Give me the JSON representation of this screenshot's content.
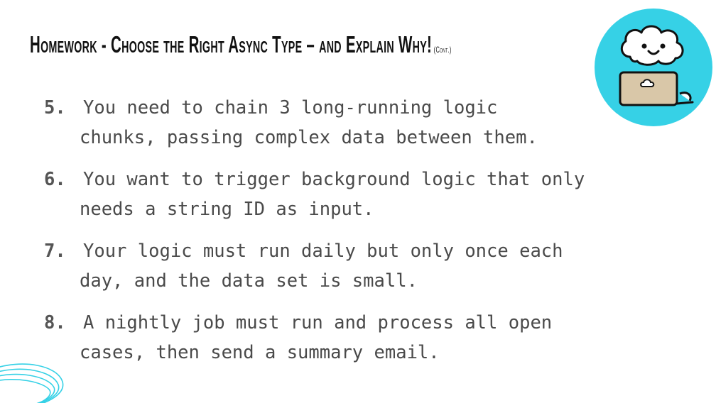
{
  "slide": {
    "title": "Homework - Choose the Right Async Type – and Explain Why!",
    "title_suffix": "(Cont.)"
  },
  "items": [
    {
      "number": "5.",
      "line1": "You need to chain 3 long-running logic",
      "line2": "chunks, passing complex data between them."
    },
    {
      "number": "6.",
      "line1": "You want to trigger background logic that only",
      "line2": "needs a string ID as input."
    },
    {
      "number": "7.",
      "line1": "Your logic must run daily but only once each",
      "line2": "day, and the data set is small."
    },
    {
      "number": "8.",
      "line1": "A nightly job must run and process all open",
      "line2": "cases, then send a summary email."
    }
  ],
  "colors": {
    "mascot_bg": "#36d1e6",
    "swirl": "#36d1e6",
    "text": "#4a4a4a"
  },
  "icons": {
    "mascot": "cloud-character-with-laptop-icon",
    "decoration": "cyan-swirl-lines"
  }
}
